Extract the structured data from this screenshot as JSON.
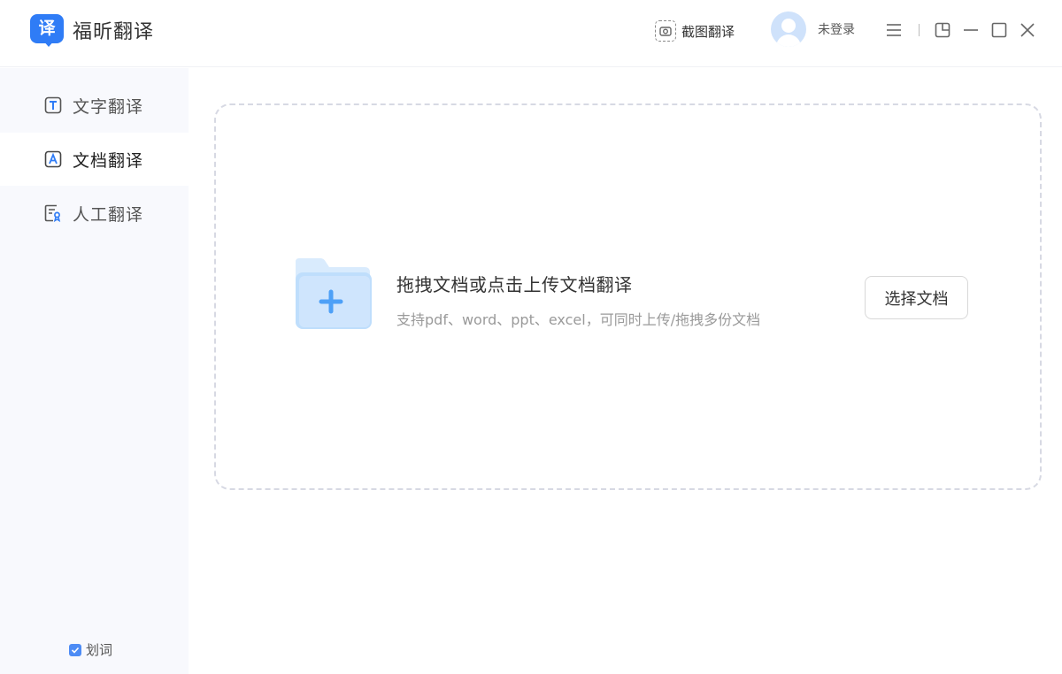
{
  "app": {
    "logo_char": "译",
    "name": "福昕翻译"
  },
  "header": {
    "screenshot_translate": "截图翻译",
    "user_status": "未登录"
  },
  "sidebar": {
    "items": [
      {
        "label": "文字翻译",
        "icon": "text-translate-icon"
      },
      {
        "label": "文档翻译",
        "icon": "document-translate-icon",
        "active": true
      },
      {
        "label": "人工翻译",
        "icon": "human-translate-icon"
      }
    ],
    "word_pick_label": "划词",
    "word_pick_checked": true
  },
  "dropzone": {
    "title": "拖拽文档或点击上传文档翻译",
    "subtitle": "支持pdf、word、ppt、excel，可同时上传/拖拽多份文档",
    "choose_button": "选择文档"
  },
  "colors": {
    "accent": "#2f7cf6",
    "sidebar_bg": "#f8f9fd",
    "dashed_border": "#d7d9e3"
  }
}
